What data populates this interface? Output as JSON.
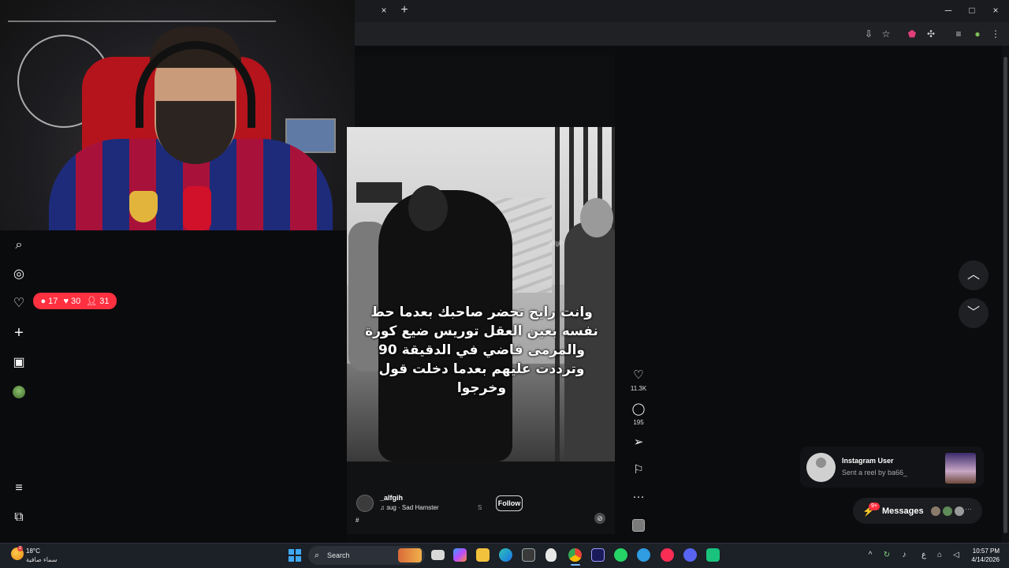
{
  "browser": {
    "tab_close": "×",
    "tab_new": "+",
    "window_controls": {
      "minimize": "─",
      "maximize": "□",
      "close": "×"
    },
    "toolbar_icons": [
      "install-app-icon",
      "bookmark-star-icon",
      "extension-shield-icon",
      "extensions-puzzle-icon",
      "media-control-icon",
      "profile-icon",
      "more-menu-icon"
    ]
  },
  "sidebar": {
    "icons": [
      "search-icon",
      "explore-compass-icon",
      "notifications-heart-icon",
      "create-plus-icon",
      "insights-chart-icon",
      "profile-avatar",
      "more-menu-icon",
      "also-from-meta-icon"
    ],
    "notifications": {
      "comments": "17",
      "likes": "30",
      "followers": "31"
    }
  },
  "reel": {
    "caption": "وانت رايح تحضر صاحبك بعدما حط نفسه بعين العقل توريس ضيع كورة والمرمى فاضي في الدقيقة 90 وترددت عليهم بعدما دخلت قول وخرجوا",
    "watermark": "alfgih",
    "username": "_alfgih",
    "audio": "ɜug · Sad Hamster",
    "audio_sep": "S",
    "follow_label": "Follow",
    "hashtag": "#"
  },
  "actions": {
    "like_count": "11.3K",
    "comment_count": "195"
  },
  "toast": {
    "title": "Instagram User",
    "subtitle": "Sent a reel by ba66_"
  },
  "messages": {
    "label": "Messages",
    "badge": "9+",
    "more": "···"
  },
  "taskbar": {
    "temperature": "18°C",
    "condition": "سماء صافية",
    "weather_badge": "2",
    "search_label": "Search",
    "time": "10:57 PM",
    "date": "4/14/2026",
    "tray_lang": "ع"
  },
  "colors": {
    "accent_red": "#ff3040",
    "background": "#0b0c0e",
    "taskbar": "#1c2027"
  }
}
